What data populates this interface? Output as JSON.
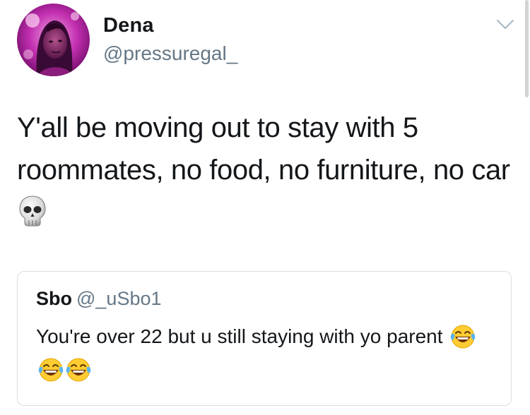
{
  "tweet": {
    "author": {
      "display_name": "Dena",
      "handle": "@pressuregal_",
      "avatar_icon": "profile-photo"
    },
    "menu_icon": "chevron-down-icon",
    "text": "Y'all be moving out to stay with 5 roommates, no food, no furniture, no car",
    "emoji": "skull"
  },
  "quoted_tweet": {
    "display_name": "Sbo",
    "handle": "@_uSbo1",
    "text": "You're over 22 but u still staying with yo parent",
    "emoji": [
      "face-with-tears-of-joy",
      "face-with-tears-of-joy",
      "face-with-tears-of-joy"
    ]
  },
  "colors": {
    "text_primary": "#14171a",
    "text_secondary": "#657786",
    "card_border": "#d8dee3",
    "emoji_yellow": "#ffcc33",
    "tear_blue": "#59b5f0"
  }
}
